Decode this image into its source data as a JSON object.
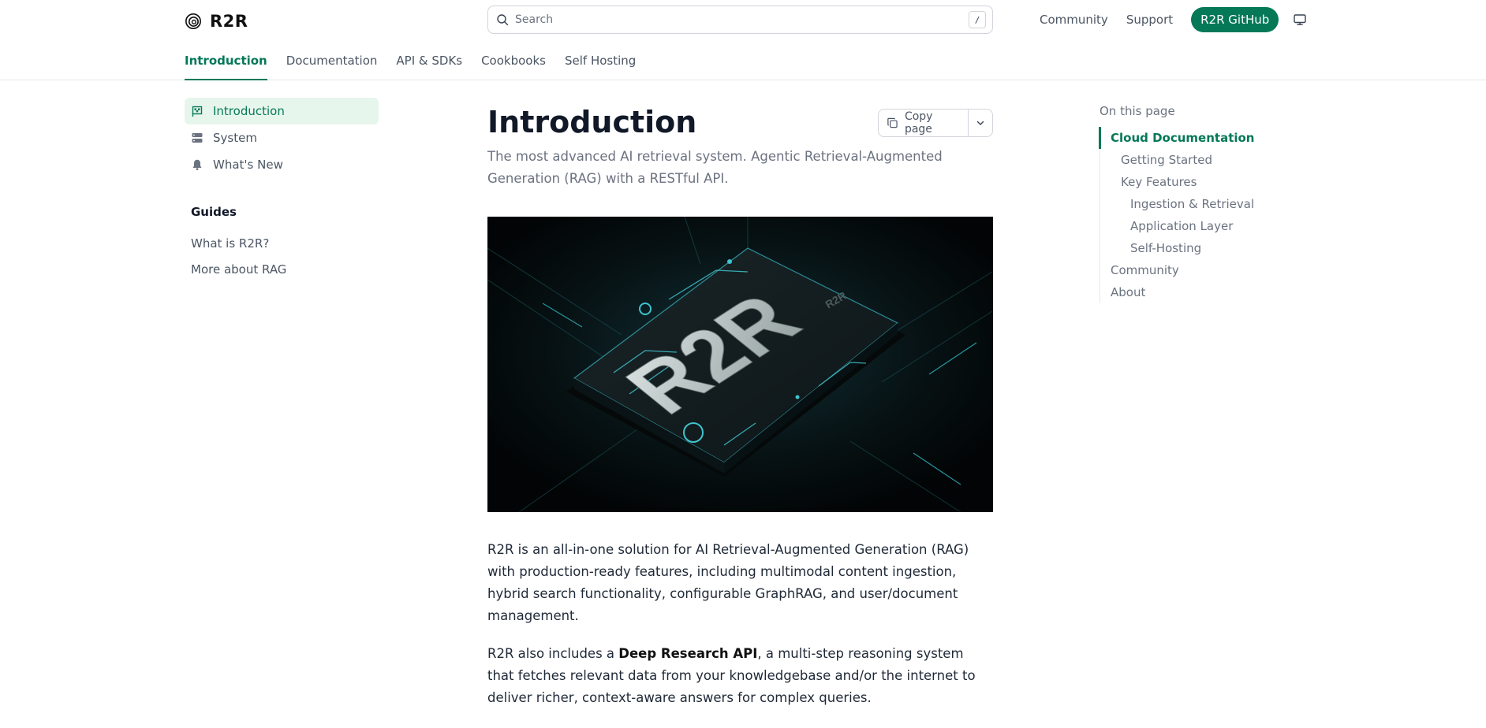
{
  "brand": {
    "name": "R2R"
  },
  "search": {
    "placeholder": "Search",
    "shortcut": "/"
  },
  "topnav": {
    "links": [
      "Community",
      "Support"
    ],
    "github_label": "R2R GitHub"
  },
  "tabs": [
    "Introduction",
    "Documentation",
    "API & SDKs",
    "Cookbooks",
    "Self Hosting"
  ],
  "sidebar": {
    "items": [
      {
        "label": "Introduction",
        "icon": "flag-icon"
      },
      {
        "label": "System",
        "icon": "server-icon"
      },
      {
        "label": "What's New",
        "icon": "bell-icon"
      }
    ],
    "guides_heading": "Guides",
    "guides": [
      "What is R2R?",
      "More about RAG"
    ]
  },
  "main": {
    "title": "Introduction",
    "copy_label": "Copy page",
    "subtitle": "The most advanced AI retrieval system. Agentic Retrieval-Augmented Generation (RAG) with a RESTful API.",
    "hero_text": "R2R",
    "p1": "R2R is an all-in-one solution for AI Retrieval-Augmented Generation (RAG) with production-ready features, including multimodal content ingestion, hybrid search functionality, configurable GraphRAG, and user/document management.",
    "p2_prefix": "R2R also includes a ",
    "p2_bold": "Deep Research API",
    "p2_suffix": ", a multi-step reasoning system that fetches relevant data from your knowledgebase and/or the internet to deliver richer, context-aware answers for complex queries."
  },
  "toc": {
    "heading": "On this page",
    "items": [
      {
        "label": "Cloud Documentation",
        "level": 0,
        "active": true
      },
      {
        "label": "Getting Started",
        "level": 1
      },
      {
        "label": "Key Features",
        "level": 1
      },
      {
        "label": "Ingestion & Retrieval",
        "level": 2
      },
      {
        "label": "Application Layer",
        "level": 2
      },
      {
        "label": "Self-Hosting",
        "level": 2
      },
      {
        "label": "Community",
        "level": 0
      },
      {
        "label": "About",
        "level": 0
      }
    ]
  },
  "colors": {
    "accent": "#047857",
    "accent_bg": "#e7f6ec"
  }
}
